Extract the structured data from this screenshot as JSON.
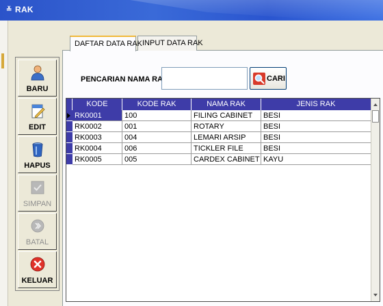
{
  "window": {
    "title": "RAK",
    "title_icon": "≚"
  },
  "tabs": [
    {
      "label": "DAFTAR DATA RAK",
      "active": true
    },
    {
      "label": "INPUT DATA RAK",
      "active": false
    }
  ],
  "toolbar": {
    "items": [
      {
        "label": "BARU",
        "icon": "user-icon",
        "enabled": true
      },
      {
        "label": "EDIT",
        "icon": "edit-icon",
        "enabled": true
      },
      {
        "label": "HAPUS",
        "icon": "trash-icon",
        "enabled": true
      },
      {
        "label": "SIMPAN",
        "icon": "check-icon",
        "enabled": false
      },
      {
        "label": "BATAL",
        "icon": "cancel-icon",
        "enabled": false
      },
      {
        "label": "KELUAR",
        "icon": "close-icon",
        "enabled": true
      }
    ]
  },
  "search": {
    "label": "PENCARIAN NAMA RAK",
    "value": "",
    "button_label": "CARI",
    "button_icon": "search-icon"
  },
  "table": {
    "columns": [
      "KODE",
      "KODE RAK",
      "NAMA RAK",
      "JENIS RAK"
    ],
    "rows": [
      [
        "RK0001",
        "100",
        "FILING CABINET",
        "BESI"
      ],
      [
        "RK0002",
        "001",
        "ROTARY",
        "BESI"
      ],
      [
        "RK0003",
        "004",
        "LEMARI ARSIP",
        "BESI"
      ],
      [
        "RK0004",
        "006",
        "TICKLER FILE",
        "BESI"
      ],
      [
        "RK0005",
        "005",
        "CARDEX CABINET",
        "KAYU"
      ]
    ],
    "selected_row": 0
  },
  "colors": {
    "accent": "#3e3ca8",
    "titlebar": "#2b53c9",
    "tab_highlight": "#f0b838"
  }
}
